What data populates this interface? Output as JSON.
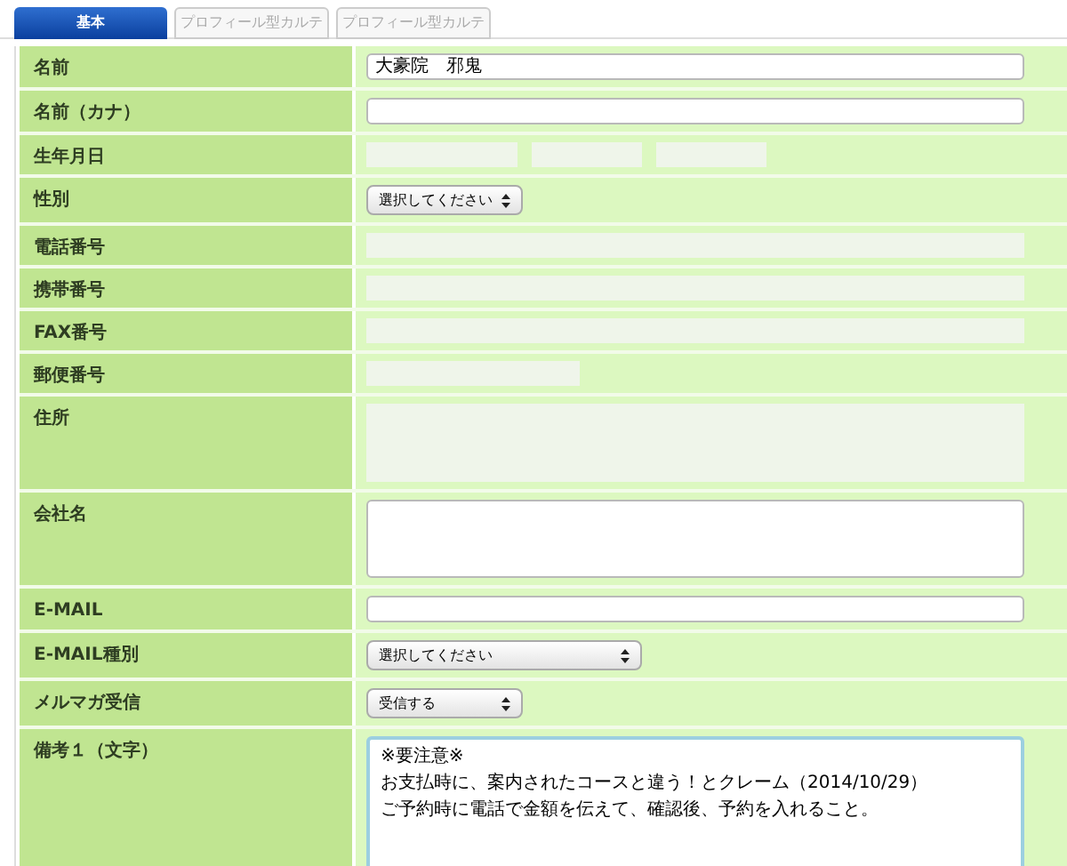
{
  "tabs": [
    {
      "label": "基本",
      "selected": true
    },
    {
      "label": "プロフィール型カルテ",
      "selected": false
    },
    {
      "label": "プロフィール型カルテ",
      "selected": false
    }
  ],
  "rows": [
    {
      "label": "名前",
      "kind": "text",
      "value": "大豪院　邪鬼"
    },
    {
      "label": "名前（カナ）",
      "kind": "text"
    },
    {
      "label": "生年月日",
      "kind": "redacted_date"
    },
    {
      "label": "性別",
      "kind": "select_small",
      "value": "選択してください"
    },
    {
      "label": "電話番号",
      "kind": "redacted"
    },
    {
      "label": "携帯番号",
      "kind": "redacted"
    },
    {
      "label": "FAX番号",
      "kind": "redacted"
    },
    {
      "label": "郵便番号",
      "kind": "redacted_short"
    },
    {
      "label": "住所",
      "kind": "redacted_area"
    },
    {
      "label": "会社名",
      "kind": "textarea"
    },
    {
      "label": "E-MAIL",
      "kind": "text"
    },
    {
      "label": "E-MAIL種別",
      "kind": "select_large",
      "value": "選択してください"
    },
    {
      "label": "メルマガ受信",
      "kind": "select_small",
      "value": "受信する"
    },
    {
      "label": "備考１（文字）",
      "kind": "textarea",
      "focused": true,
      "lines": [
        "※要注意※",
        "お支払時に、案内されたコースと違う！とクレーム（2014/10/29）",
        "ご予約時に電話で金額を伝えて、確認後、予約を入れること。"
      ]
    }
  ]
}
